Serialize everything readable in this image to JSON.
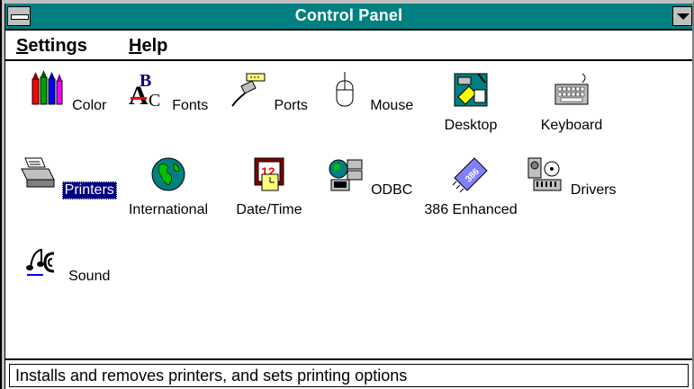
{
  "window": {
    "title": "Control Panel"
  },
  "menu": {
    "items": [
      {
        "label": "Settings"
      },
      {
        "label": "Help"
      }
    ]
  },
  "icons": [
    {
      "label": "Color",
      "icon": "color-icon",
      "selected": false
    },
    {
      "label": "Fonts",
      "icon": "fonts-icon",
      "selected": false
    },
    {
      "label": "Ports",
      "icon": "ports-icon",
      "selected": false
    },
    {
      "label": "Mouse",
      "icon": "mouse-icon",
      "selected": false
    },
    {
      "label": "Desktop",
      "icon": "desktop-icon",
      "selected": false
    },
    {
      "label": "Keyboard",
      "icon": "keyboard-icon",
      "selected": false
    },
    {
      "label": "Printers",
      "icon": "printers-icon",
      "selected": true
    },
    {
      "label": "International",
      "icon": "international-icon",
      "selected": false
    },
    {
      "label": "Date/Time",
      "icon": "date-time-icon",
      "selected": false
    },
    {
      "label": "ODBC",
      "icon": "odbc-icon",
      "selected": false
    },
    {
      "label": "386 Enhanced",
      "icon": "386-enhanced-icon",
      "selected": false
    },
    {
      "label": "Drivers",
      "icon": "drivers-icon",
      "selected": false
    },
    {
      "label": "Sound",
      "icon": "sound-icon",
      "selected": false
    }
  ],
  "status": {
    "text": "Installs and removes printers, and sets printing options"
  },
  "colors": {
    "titlebar": "#008080",
    "selection": "#000080"
  }
}
